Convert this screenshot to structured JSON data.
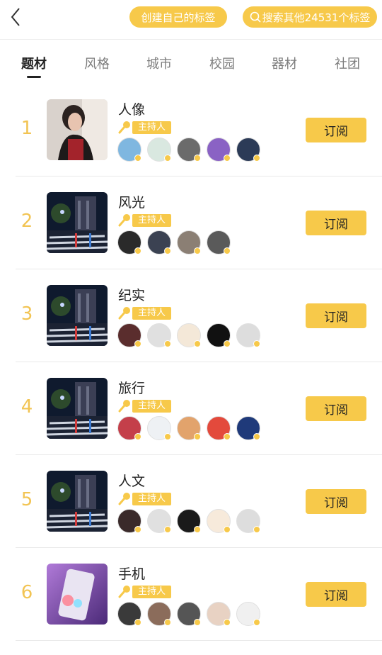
{
  "header": {
    "create_label": "创建自己的标签",
    "search_label": "搜索其他24531个标签"
  },
  "tabs": [
    {
      "label": "题材",
      "active": true
    },
    {
      "label": "风格"
    },
    {
      "label": "城市"
    },
    {
      "label": "校园"
    },
    {
      "label": "器材"
    },
    {
      "label": "社团"
    }
  ],
  "colors": {
    "accent": "#f7c94a",
    "rank": "#f2c453"
  },
  "tags": [
    {
      "rank": "1",
      "name": "人像",
      "host_label": "主持人",
      "button_label": "订阅",
      "thumb": "portrait"
    },
    {
      "rank": "2",
      "name": "风光",
      "host_label": "主持人",
      "button_label": "订阅",
      "thumb": "night-city"
    },
    {
      "rank": "3",
      "name": "纪实",
      "host_label": "主持人",
      "button_label": "订阅",
      "thumb": "night-city"
    },
    {
      "rank": "4",
      "name": "旅行",
      "host_label": "主持人",
      "button_label": "订阅",
      "thumb": "night-city"
    },
    {
      "rank": "5",
      "name": "人文",
      "host_label": "主持人",
      "button_label": "订阅",
      "thumb": "night-city"
    },
    {
      "rank": "6",
      "name": "手机",
      "host_label": "主持人",
      "button_label": "订阅",
      "thumb": "phone"
    }
  ]
}
